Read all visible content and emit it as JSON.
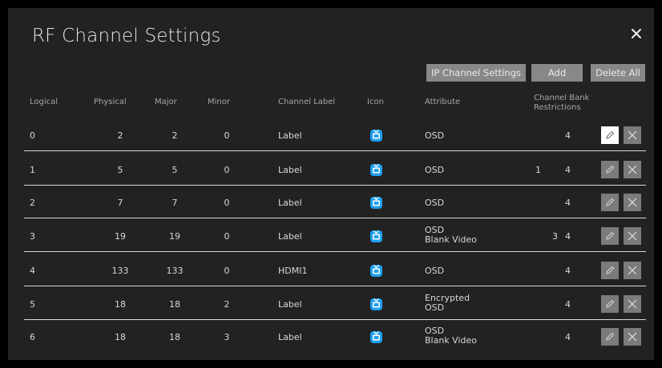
{
  "dialog": {
    "title": "RF Channel Settings",
    "close_icon": "close-icon"
  },
  "toolbar": {
    "ip_channel_settings_label": "IP Channel Settings",
    "add_label": "Add",
    "delete_all_label": "Delete All"
  },
  "columns": {
    "logical": "Logical",
    "physical": "Physical",
    "major": "Major",
    "minor": "Minor",
    "channel_label": "Channel Label",
    "icon": "Icon",
    "attribute": "Attribute",
    "channel_bank_line1": "Channel Bank",
    "channel_bank_line2": "Restrictions"
  },
  "rows": [
    {
      "logical": "0",
      "physical": "2",
      "major": "2",
      "minor": "0",
      "label": "Label",
      "attr1": "OSD",
      "attr2": "",
      "bank_a": "",
      "bank_b": "4"
    },
    {
      "logical": "1",
      "physical": "5",
      "major": "5",
      "minor": "0",
      "label": "Label",
      "attr1": "OSD",
      "attr2": "",
      "bank_a": "1",
      "bank_b": "4"
    },
    {
      "logical": "2",
      "physical": "7",
      "major": "7",
      "minor": "0",
      "label": "Label",
      "attr1": "OSD",
      "attr2": "",
      "bank_a": "",
      "bank_b": "4"
    },
    {
      "logical": "3",
      "physical": "19",
      "major": "19",
      "minor": "0",
      "label": "Label",
      "attr1": "OSD",
      "attr2": "Blank Video",
      "bank_a": "3",
      "bank_b": "4"
    },
    {
      "logical": "4",
      "physical": "133",
      "major": "133",
      "minor": "0",
      "label": "HDMI1",
      "attr1": "OSD",
      "attr2": "",
      "bank_a": "",
      "bank_b": "4"
    },
    {
      "logical": "5",
      "physical": "18",
      "major": "18",
      "minor": "2",
      "label": "Label",
      "attr1": "Encrypted",
      "attr2": "OSD",
      "bank_a": "",
      "bank_b": "4"
    },
    {
      "logical": "6",
      "physical": "18",
      "major": "18",
      "minor": "3",
      "label": "Label",
      "attr1": "OSD",
      "attr2": "Blank Video",
      "bank_a": "",
      "bank_b": "4"
    }
  ],
  "icons": {
    "row_icon": "tv-icon",
    "edit": "pencil-icon",
    "delete": "close-icon"
  },
  "colors": {
    "background": "#222222",
    "button": "#888888",
    "tv_icon": "#1ea0f0",
    "active_edit": "#ffffff"
  }
}
